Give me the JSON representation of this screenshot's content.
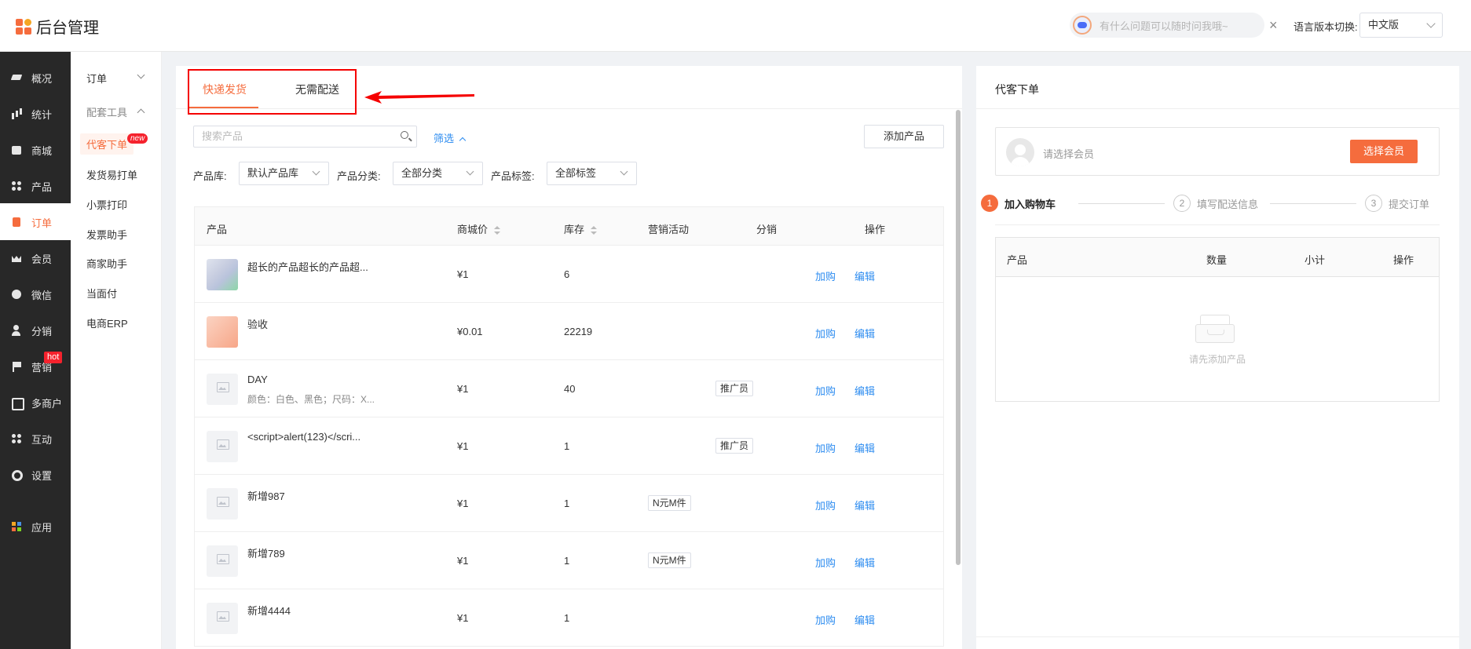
{
  "header": {
    "brand_title": "后台管理",
    "assistant_placeholder": "有什么问题可以随时问我哦~",
    "close_glyph": "×",
    "language_label": "语言版本切换:",
    "language_value": "中文版"
  },
  "sidebar": {
    "items": [
      {
        "label": "概况",
        "icon": "layers-icon"
      },
      {
        "label": "统计",
        "icon": "chart-icon"
      },
      {
        "label": "商城",
        "icon": "store-icon"
      },
      {
        "label": "产品",
        "icon": "grid-icon"
      },
      {
        "label": "订单",
        "icon": "clipboard-icon",
        "active": true
      },
      {
        "label": "会员",
        "icon": "crown-icon"
      },
      {
        "label": "微信",
        "icon": "wechat-icon"
      },
      {
        "label": "分销",
        "icon": "user-icon"
      },
      {
        "label": "营销",
        "icon": "flag-icon",
        "badge": "hot"
      },
      {
        "label": "多商户",
        "icon": "shop-icon"
      },
      {
        "label": "互动",
        "icon": "grid-icon"
      },
      {
        "label": "设置",
        "icon": "gear-icon"
      },
      {
        "label": "应用",
        "icon": "apps-icon"
      }
    ]
  },
  "submenu": {
    "order_group": "订单",
    "tools_group": "配套工具",
    "active_item": "代客下单",
    "new_badge": "new",
    "items": [
      "发货易打单",
      "小票打印",
      "发票助手",
      "商家助手",
      "当面付",
      "电商ERP"
    ]
  },
  "main": {
    "tabs": [
      "快递发货",
      "无需配送"
    ],
    "active_tab": 0,
    "search_placeholder": "搜索产品",
    "filter_label": "筛选",
    "add_product_label": "添加产品",
    "filters": [
      {
        "label": "产品库:",
        "value": "默认产品库"
      },
      {
        "label": "产品分类:",
        "value": "全部分类"
      },
      {
        "label": "产品标签:",
        "value": "全部标签"
      }
    ],
    "table": {
      "headers": [
        "产品",
        "商城价",
        "库存",
        "营销活动",
        "分销",
        "操作"
      ],
      "actions": [
        "加购",
        "编辑"
      ],
      "rows": [
        {
          "name": "超长的产品超长的产品超...",
          "sub": "",
          "price": "¥1",
          "stock": "6",
          "promo": "",
          "dist": "",
          "thumb": "pix"
        },
        {
          "name": "验收",
          "sub": "",
          "price": "¥0.01",
          "stock": "22219",
          "promo": "",
          "dist": "",
          "thumb": "peach"
        },
        {
          "name": "DAY",
          "sub": "颜色：白色、黑色；尺码：X...",
          "price": "¥1",
          "stock": "40",
          "promo": "",
          "dist": "推广员",
          "thumb": "ph"
        },
        {
          "name": "<script>alert(123)</scri...",
          "sub": "",
          "price": "¥1",
          "stock": "1",
          "promo": "",
          "dist": "推广员",
          "thumb": "ph"
        },
        {
          "name": "新增987",
          "sub": "",
          "price": "¥1",
          "stock": "1",
          "promo": "N元M件",
          "dist": "",
          "thumb": "ph"
        },
        {
          "name": "新增789",
          "sub": "",
          "price": "¥1",
          "stock": "1",
          "promo": "N元M件",
          "dist": "",
          "thumb": "ph"
        },
        {
          "name": "新增4444",
          "sub": "",
          "price": "¥1",
          "stock": "1",
          "promo": "",
          "dist": "",
          "thumb": "ph"
        }
      ]
    }
  },
  "right": {
    "title": "代客下单",
    "member_placeholder": "请选择会员",
    "select_member_label": "选择会员",
    "steps": [
      {
        "num": "1",
        "label": "加入购物车"
      },
      {
        "num": "2",
        "label": "填写配送信息"
      },
      {
        "num": "3",
        "label": "提交订单"
      }
    ],
    "cart_headers": [
      "产品",
      "数量",
      "小计",
      "操作"
    ],
    "empty_text": "请先添加产品"
  },
  "colors": {
    "accent": "#f56c3d",
    "link": "#2d8cf0",
    "sidebar_bg": "#282828",
    "annotation": "#f50000"
  }
}
